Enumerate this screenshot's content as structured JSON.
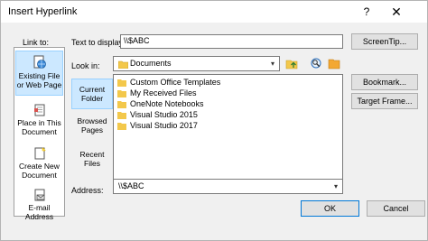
{
  "dialog": {
    "title": "Insert Hyperlink",
    "help_glyph": "?",
    "close_glyph": "✕"
  },
  "link_to": {
    "label": "Link to:",
    "items": [
      {
        "line1": "Existing File",
        "line2": "or Web Page",
        "icon": "globe-page-icon",
        "selected": true
      },
      {
        "line1": "Place in This",
        "line2": "Document",
        "icon": "document-place-icon",
        "selected": false
      },
      {
        "line1": "Create New",
        "line2": "Document",
        "icon": "new-document-icon",
        "selected": false
      },
      {
        "line1": "E-mail",
        "line2": "Address",
        "icon": "email-icon",
        "selected": false
      }
    ]
  },
  "text_to_display": {
    "label": "Text to display:",
    "value": "\\\\$ABC"
  },
  "screentip_button": "ScreenTip...",
  "look_in": {
    "label": "Look in:",
    "value": "Documents"
  },
  "nav": {
    "items": [
      {
        "line1": "Current",
        "line2": "Folder",
        "selected": true
      },
      {
        "line1": "Browsed",
        "line2": "Pages",
        "selected": false
      },
      {
        "line1": "Recent",
        "line2": "Files",
        "selected": false
      }
    ]
  },
  "files": [
    "Custom Office Templates",
    "My Received Files",
    "OneNote Notebooks",
    "Visual Studio 2015",
    "Visual Studio 2017"
  ],
  "bookmark_button": "Bookmark...",
  "target_frame_button": "Target Frame...",
  "address": {
    "label": "Address:",
    "value": "\\\\$ABC"
  },
  "ok_button": "OK",
  "cancel_button": "Cancel",
  "colors": {
    "selection": "#cce8ff",
    "selection_border": "#99d1ff",
    "folder": "#f3c84b",
    "default_button_border": "#0078d7"
  }
}
